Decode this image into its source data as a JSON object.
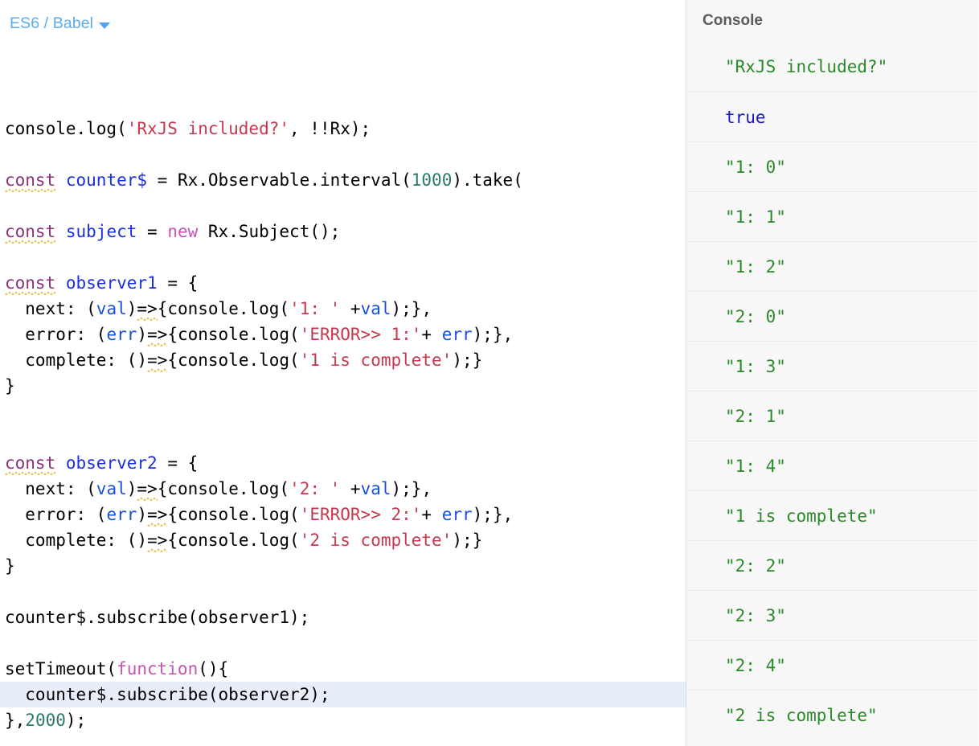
{
  "editor": {
    "mode_label": "ES6 / Babel",
    "dropdown_icon": "chevron-down-icon",
    "highlighted_line_index": 22,
    "lines": [
      {
        "id": 0,
        "text": "console.log('RxJS included?', !!Rx);"
      },
      {
        "id": 1,
        "text": ""
      },
      {
        "id": 2,
        "text": "const counter$ = Rx.Observable.interval(1000).take("
      },
      {
        "id": 3,
        "text": ""
      },
      {
        "id": 4,
        "text": "const subject = new Rx.Subject();"
      },
      {
        "id": 5,
        "text": ""
      },
      {
        "id": 6,
        "text": "const observer1 = {"
      },
      {
        "id": 7,
        "text": "  next: (val)=>{console.log('1: ' +val);},"
      },
      {
        "id": 8,
        "text": "  error: (err)=>{console.log('ERROR>> 1:'+ err);},"
      },
      {
        "id": 9,
        "text": "  complete: ()=>{console.log('1 is complete');}"
      },
      {
        "id": 10,
        "text": "}"
      },
      {
        "id": 11,
        "text": ""
      },
      {
        "id": 12,
        "text": ""
      },
      {
        "id": 13,
        "text": "const observer2 = {"
      },
      {
        "id": 14,
        "text": "  next: (val)=>{console.log('2: ' +val);},"
      },
      {
        "id": 15,
        "text": "  error: (err)=>{console.log('ERROR>> 2:'+ err);},"
      },
      {
        "id": 16,
        "text": "  complete: ()=>{console.log('2 is complete');}"
      },
      {
        "id": 17,
        "text": "}"
      },
      {
        "id": 18,
        "text": ""
      },
      {
        "id": 19,
        "text": "counter$.subscribe(observer1);"
      },
      {
        "id": 20,
        "text": ""
      },
      {
        "id": 21,
        "text": "setTimeout(function(){"
      },
      {
        "id": 22,
        "text": "  counter$.subscribe(observer2);"
      },
      {
        "id": 23,
        "text": "},2000);"
      }
    ]
  },
  "console": {
    "title": "Console",
    "entries": [
      {
        "text": "\"RxJS included?\"",
        "type": "string"
      },
      {
        "text": "true",
        "type": "boolean"
      },
      {
        "text": "\"1: 0\"",
        "type": "string"
      },
      {
        "text": "\"1: 1\"",
        "type": "string"
      },
      {
        "text": "\"1: 2\"",
        "type": "string"
      },
      {
        "text": "\"2: 0\"",
        "type": "string"
      },
      {
        "text": "\"1: 3\"",
        "type": "string"
      },
      {
        "text": "\"2: 1\"",
        "type": "string"
      },
      {
        "text": "\"1: 4\"",
        "type": "string"
      },
      {
        "text": "\"1 is complete\"",
        "type": "string"
      },
      {
        "text": "\"2: 2\"",
        "type": "string"
      },
      {
        "text": "\"2: 3\"",
        "type": "string"
      },
      {
        "text": "\"2: 4\"",
        "type": "string"
      },
      {
        "text": "\"2 is complete\"",
        "type": "string"
      }
    ]
  },
  "colors": {
    "accent_blue": "#5aabf2",
    "keyword_purple": "#8c2f7c",
    "keyword_pink": "#c455b4",
    "identifier_blue": "#1a2fe0",
    "string_red": "#c7384f",
    "number_teal": "#2c7a6a",
    "console_string_green": "#2a8a2a",
    "console_boolean_blue": "#1a1ab8",
    "highlight_line": "#e8eef9",
    "squiggle_yellow": "#e8c96a"
  }
}
